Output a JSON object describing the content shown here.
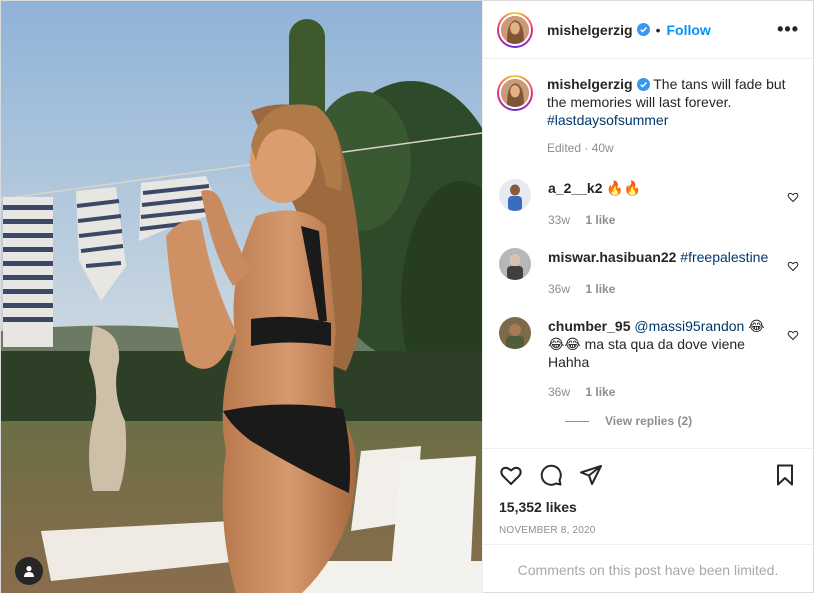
{
  "post": {
    "username": "mishelgerzig",
    "follow_label": "Follow",
    "separator": "•",
    "more_label": "•••",
    "caption_text": "The tans will fade but the memories will last forever.",
    "caption_hashtag": "#lastdaysofsummer",
    "caption_meta": "Edited · 40w",
    "likes": "15,352 likes",
    "date": "NOVEMBER 8, 2020",
    "comments_limited": "Comments on this post have been limited."
  },
  "comments": [
    {
      "username": "a_2__k2",
      "text": "🔥🔥",
      "mention": "",
      "age": "33w",
      "likes": "1 like"
    },
    {
      "username": "miswar.hasibuan22",
      "text": "",
      "mention": "#freepalestine",
      "age": "36w",
      "likes": "1 like"
    },
    {
      "username": "chumber_95",
      "text": "😂😂😂 ma sta qua da dove viene Hahha",
      "mention": "@massi95randon",
      "age": "36w",
      "likes": "1 like"
    }
  ],
  "view_replies": "View replies (2)",
  "colors": {
    "accent": "#0095f6",
    "link": "#00376b",
    "muted": "#8e8e8e",
    "verified": "#3897f0"
  },
  "icons": [
    "verified-badge-icon",
    "more-options-icon",
    "heart-icon",
    "comment-icon",
    "share-icon",
    "bookmark-icon",
    "user-tag-icon"
  ]
}
